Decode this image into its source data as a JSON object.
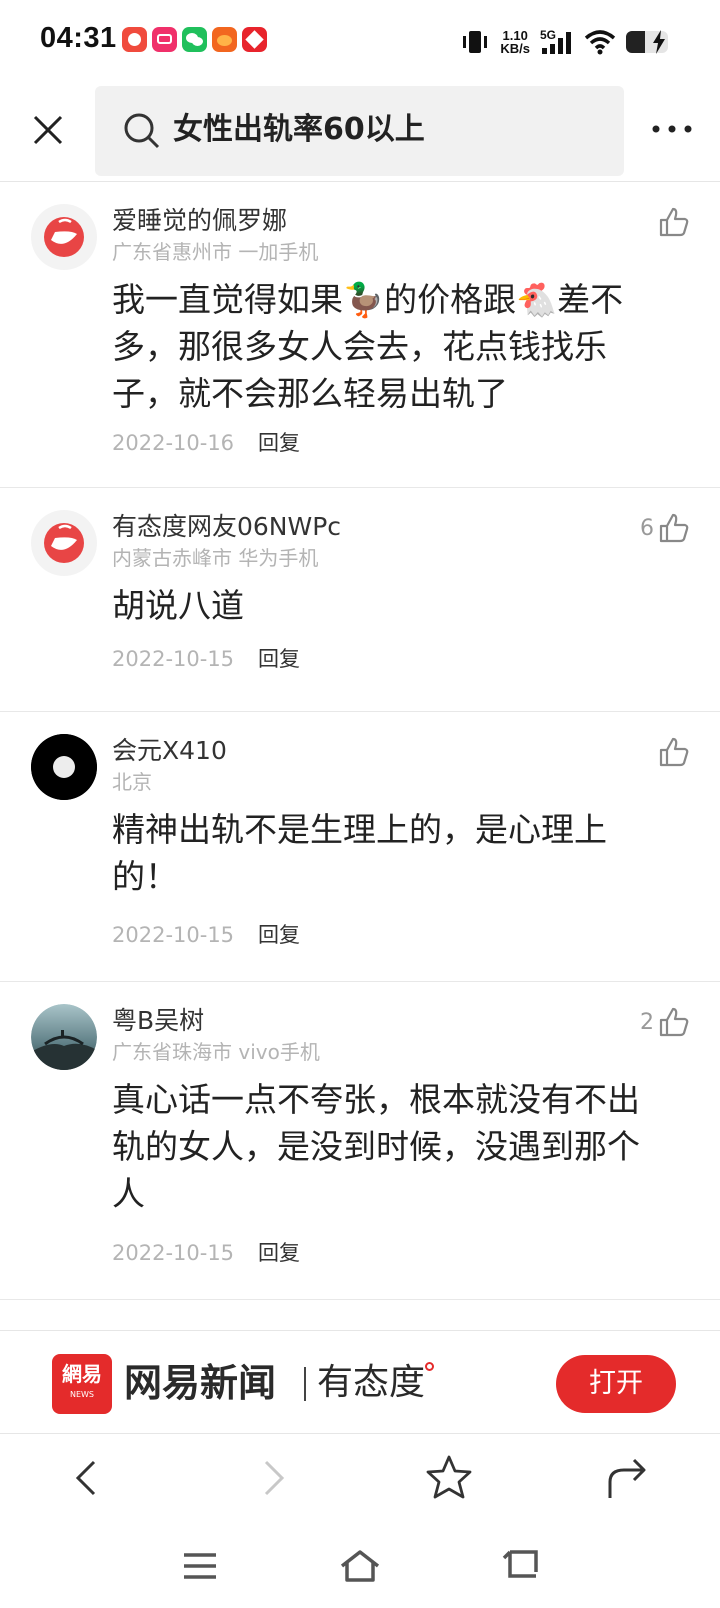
{
  "status_bar": {
    "time": "04:31",
    "net_speed_value": "1.10",
    "net_speed_unit": "KB/s",
    "network": "5G",
    "app_icons": [
      "app-icon-1",
      "app-icon-2",
      "wechat-icon",
      "app-icon-4",
      "app-icon-5"
    ]
  },
  "search": {
    "query": "女性出轨率60以上"
  },
  "comments": [
    {
      "name": "爱睡觉的佩罗娜",
      "location": "广东省惠州市 一加手机",
      "text_lines": [
        "我一直觉得如果🦆的价格跟🐔差不",
        "多，那很多女人会去，花点钱找乐",
        "子，就不会那么轻易出轨了"
      ],
      "date": "2022-10-16",
      "reply": "回复",
      "likes": ""
    },
    {
      "name": "有态度网友06NWPc",
      "location": "内蒙古赤峰市 华为手机",
      "text_lines": [
        "胡说八道"
      ],
      "date": "2022-10-15",
      "reply": "回复",
      "likes": "6"
    },
    {
      "name": "会元X410",
      "location": "北京",
      "text_lines": [
        "精神出轨不是生理上的，是心理上",
        "的！"
      ],
      "date": "2022-10-15",
      "reply": "回复",
      "likes": ""
    },
    {
      "name": "粤B吴树",
      "location": "广东省珠海市 vivo手机",
      "text_lines": [
        "真心话一点不夸张，根本就没有不出",
        "轨的女人，是没到时候，没遇到那个",
        "人"
      ],
      "date": "2022-10-15",
      "reply": "回复",
      "likes": "2"
    }
  ],
  "banner": {
    "logo_text": "網易",
    "logo_sub": "NEWS",
    "brand": "网易新闻",
    "slogan": "有态度",
    "open_label": "打开"
  },
  "colors": {
    "accent": "#e42b2b",
    "muted_text": "#b4b4b4"
  }
}
